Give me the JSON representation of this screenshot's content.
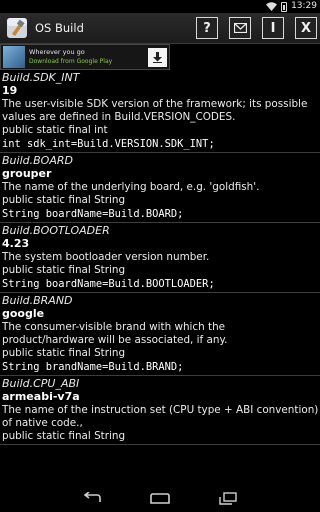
{
  "status_bar": {
    "time": "13:29"
  },
  "app": {
    "title": "OS Build"
  },
  "toolbar": {
    "help_label": "?",
    "info_label": "I",
    "exit_label": "X"
  },
  "ad": {
    "title": "Wherever you go",
    "subtitle": "Download from Google Play"
  },
  "entries": [
    {
      "name": "Build.SDK_INT",
      "value": "19",
      "description": "The user-visible SDK version of the framework; its possible values are defined in Build.VERSION_CODES.",
      "declaration": "public static final int",
      "code": "int sdk_int=Build.VERSION.SDK_INT;"
    },
    {
      "name": "Build.BOARD",
      "value": "grouper",
      "description": "The name of the underlying board, e.g. 'goldfish'.",
      "declaration": "public static final String",
      "code": "String boardName=Build.BOARD;"
    },
    {
      "name": "Build.BOOTLOADER",
      "value": "4.23",
      "description": "The system bootloader version number.",
      "declaration": "public static final String",
      "code": "String boardName=Build.BOOTLOADER;"
    },
    {
      "name": "Build.BRAND",
      "value": "google",
      "description": "The consumer-visible brand with which the product/hardware will be associated, if any.",
      "declaration": "public static final String",
      "code": "String brandName=Build.BRAND;"
    },
    {
      "name": "Build.CPU_ABI",
      "value": "armeabi-v7a",
      "description": "The name of the instruction set (CPU type + ABI convention) of native code.,",
      "declaration": "public static final String",
      "code": ""
    }
  ]
}
